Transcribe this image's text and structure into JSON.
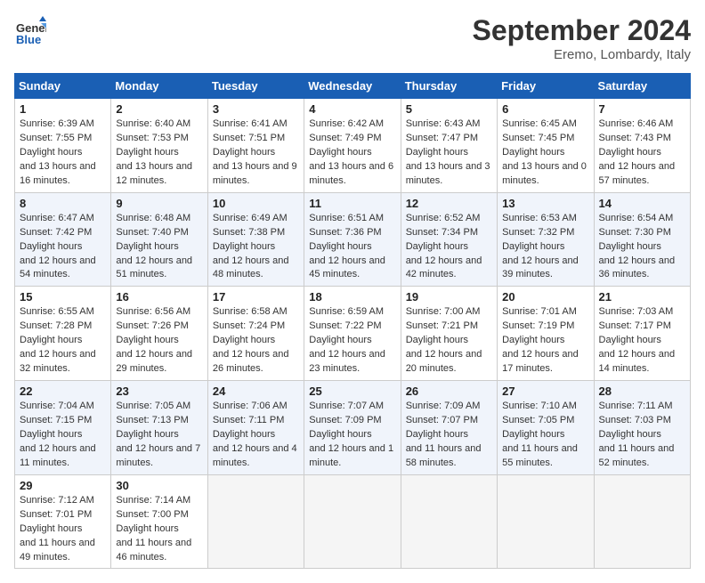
{
  "logo": {
    "line1": "General",
    "line2": "Blue"
  },
  "title": "September 2024",
  "location": "Eremo, Lombardy, Italy",
  "weekdays": [
    "Sunday",
    "Monday",
    "Tuesday",
    "Wednesday",
    "Thursday",
    "Friday",
    "Saturday"
  ],
  "weeks": [
    [
      {
        "num": "1",
        "sunrise": "6:39 AM",
        "sunset": "7:55 PM",
        "daylight": "13 hours and 16 minutes."
      },
      {
        "num": "2",
        "sunrise": "6:40 AM",
        "sunset": "7:53 PM",
        "daylight": "13 hours and 12 minutes."
      },
      {
        "num": "3",
        "sunrise": "6:41 AM",
        "sunset": "7:51 PM",
        "daylight": "13 hours and 9 minutes."
      },
      {
        "num": "4",
        "sunrise": "6:42 AM",
        "sunset": "7:49 PM",
        "daylight": "13 hours and 6 minutes."
      },
      {
        "num": "5",
        "sunrise": "6:43 AM",
        "sunset": "7:47 PM",
        "daylight": "13 hours and 3 minutes."
      },
      {
        "num": "6",
        "sunrise": "6:45 AM",
        "sunset": "7:45 PM",
        "daylight": "13 hours and 0 minutes."
      },
      {
        "num": "7",
        "sunrise": "6:46 AM",
        "sunset": "7:43 PM",
        "daylight": "12 hours and 57 minutes."
      }
    ],
    [
      {
        "num": "8",
        "sunrise": "6:47 AM",
        "sunset": "7:42 PM",
        "daylight": "12 hours and 54 minutes."
      },
      {
        "num": "9",
        "sunrise": "6:48 AM",
        "sunset": "7:40 PM",
        "daylight": "12 hours and 51 minutes."
      },
      {
        "num": "10",
        "sunrise": "6:49 AM",
        "sunset": "7:38 PM",
        "daylight": "12 hours and 48 minutes."
      },
      {
        "num": "11",
        "sunrise": "6:51 AM",
        "sunset": "7:36 PM",
        "daylight": "12 hours and 45 minutes."
      },
      {
        "num": "12",
        "sunrise": "6:52 AM",
        "sunset": "7:34 PM",
        "daylight": "12 hours and 42 minutes."
      },
      {
        "num": "13",
        "sunrise": "6:53 AM",
        "sunset": "7:32 PM",
        "daylight": "12 hours and 39 minutes."
      },
      {
        "num": "14",
        "sunrise": "6:54 AM",
        "sunset": "7:30 PM",
        "daylight": "12 hours and 36 minutes."
      }
    ],
    [
      {
        "num": "15",
        "sunrise": "6:55 AM",
        "sunset": "7:28 PM",
        "daylight": "12 hours and 32 minutes."
      },
      {
        "num": "16",
        "sunrise": "6:56 AM",
        "sunset": "7:26 PM",
        "daylight": "12 hours and 29 minutes."
      },
      {
        "num": "17",
        "sunrise": "6:58 AM",
        "sunset": "7:24 PM",
        "daylight": "12 hours and 26 minutes."
      },
      {
        "num": "18",
        "sunrise": "6:59 AM",
        "sunset": "7:22 PM",
        "daylight": "12 hours and 23 minutes."
      },
      {
        "num": "19",
        "sunrise": "7:00 AM",
        "sunset": "7:21 PM",
        "daylight": "12 hours and 20 minutes."
      },
      {
        "num": "20",
        "sunrise": "7:01 AM",
        "sunset": "7:19 PM",
        "daylight": "12 hours and 17 minutes."
      },
      {
        "num": "21",
        "sunrise": "7:03 AM",
        "sunset": "7:17 PM",
        "daylight": "12 hours and 14 minutes."
      }
    ],
    [
      {
        "num": "22",
        "sunrise": "7:04 AM",
        "sunset": "7:15 PM",
        "daylight": "12 hours and 11 minutes."
      },
      {
        "num": "23",
        "sunrise": "7:05 AM",
        "sunset": "7:13 PM",
        "daylight": "12 hours and 7 minutes."
      },
      {
        "num": "24",
        "sunrise": "7:06 AM",
        "sunset": "7:11 PM",
        "daylight": "12 hours and 4 minutes."
      },
      {
        "num": "25",
        "sunrise": "7:07 AM",
        "sunset": "7:09 PM",
        "daylight": "12 hours and 1 minute."
      },
      {
        "num": "26",
        "sunrise": "7:09 AM",
        "sunset": "7:07 PM",
        "daylight": "11 hours and 58 minutes."
      },
      {
        "num": "27",
        "sunrise": "7:10 AM",
        "sunset": "7:05 PM",
        "daylight": "11 hours and 55 minutes."
      },
      {
        "num": "28",
        "sunrise": "7:11 AM",
        "sunset": "7:03 PM",
        "daylight": "11 hours and 52 minutes."
      }
    ],
    [
      {
        "num": "29",
        "sunrise": "7:12 AM",
        "sunset": "7:01 PM",
        "daylight": "11 hours and 49 minutes."
      },
      {
        "num": "30",
        "sunrise": "7:14 AM",
        "sunset": "7:00 PM",
        "daylight": "11 hours and 46 minutes."
      },
      null,
      null,
      null,
      null,
      null
    ]
  ]
}
